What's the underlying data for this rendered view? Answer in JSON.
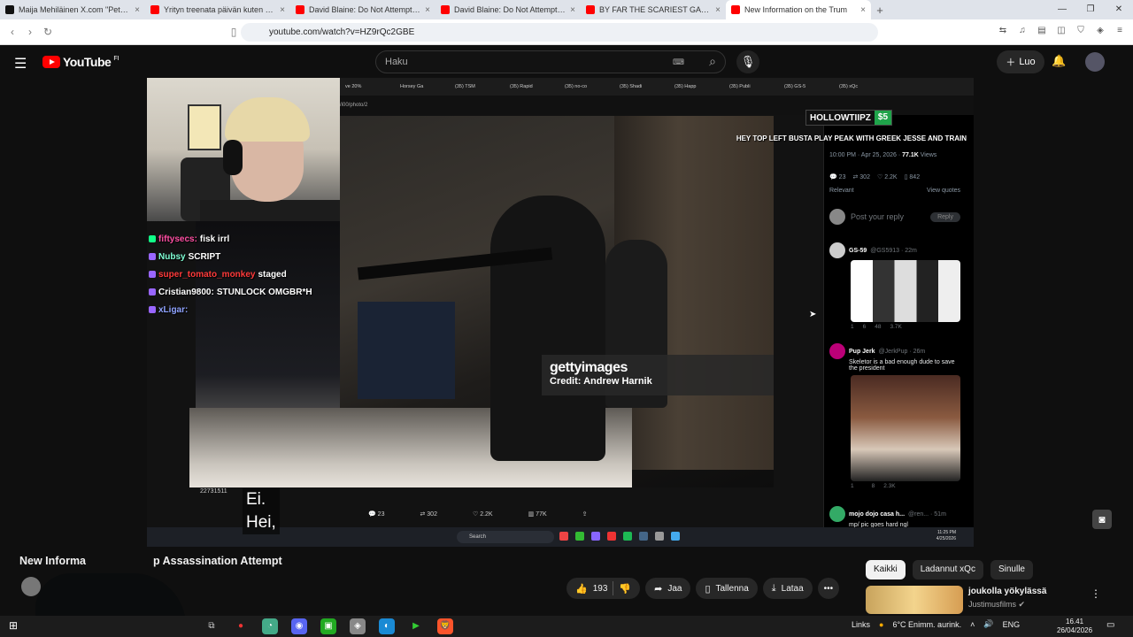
{
  "browser": {
    "tabs": [
      {
        "title": "Maija Mehiläinen X.com \"Petra Nyqvi",
        "color": "#111111"
      },
      {
        "title": "Yrityn treenata päivän kuten Khabs -",
        "color": "#ff0000"
      },
      {
        "title": "David Blaine: Do Not Attempt MEGA",
        "color": "#ff0000"
      },
      {
        "title": "David Blaine: Do Not Attempt MEGA",
        "color": "#ff0000"
      },
      {
        "title": "BY FAR THE SCARIEST GAME OF THE",
        "color": "#ff0000"
      },
      {
        "title": "New Information on the Trum",
        "color": "#ff0000",
        "active": true
      }
    ],
    "url": "youtube.com/watch?v=HZ9rQc2GBE"
  },
  "youtube": {
    "logo_text": "YouTube",
    "country_code": "FI",
    "search_placeholder": "Haku",
    "create_label": "Luo"
  },
  "stream": {
    "hollow_name": "HOLLOWTIIPZ",
    "hollow_amount": "$5",
    "alert_text": "HEY TOP LEFT BUSTA PLAY PEAK WITH GREEK JESSE AND TRAIN",
    "chat": [
      {
        "user": "fiftysecs:",
        "msg": "fisk irrl",
        "color": "#ff4fa3"
      },
      {
        "user": "Nubsy",
        "msg": "SCRIPT",
        "color": "#7fffd4"
      },
      {
        "user": "super_tomato_monkey",
        "msg": "staged",
        "color": "#ff3a3a"
      },
      {
        "user": "Cristian9800:",
        "msg": "STUNLOCK OMGBR*H",
        "color": "#ffffff"
      },
      {
        "user": "xLigar:",
        "msg": "",
        "color": "#8fa3ff"
      }
    ],
    "inner_tabs": [
      "ve 20%",
      "Horsey Ga",
      "(35) TSM",
      "(35) Rapid",
      "(35) no-co",
      "(35) Shadi",
      "(35) Happ",
      "(35) Publi",
      "(35) GS-5",
      "(35) xQc"
    ],
    "inner_url": "/i00/photo/2",
    "getty_brand": "gettyimages",
    "getty_credit": "Credit: Andrew Harnik",
    "subtitle_line1": "Ei.",
    "subtitle_line2": "Hei,",
    "video_time": "22731511"
  },
  "tweet": {
    "handle": "@GS5913",
    "timestamp": "10:00 PM · Apr 25, 2026 ·",
    "views": "77.1K",
    "views_label": "Views",
    "stats": [
      "23",
      "302",
      "2.2K",
      "842"
    ],
    "relevant": "Relevant",
    "view_quotes": "View quotes",
    "reply_placeholder": "Post your reply",
    "reply_button": "Reply",
    "bottom_stats": [
      "23",
      "302",
      "2.2K",
      "77K"
    ],
    "replies": [
      {
        "name": "GS-59",
        "handle": "@GS5913 · 22m",
        "text": "",
        "acts": [
          "1",
          "6",
          "48",
          "3.7K"
        ]
      },
      {
        "name": "Pup Jerk",
        "handle": "@JerkPup · 26m",
        "text": "Skeletor is a bad enough dude to save the president",
        "acts": [
          "1",
          "",
          "8",
          "2.3K"
        ]
      },
      {
        "name": "mojo dojo casa h...",
        "handle": "@ren... · 51m",
        "text": "mp/ pic goes hard ngl",
        "acts": []
      }
    ]
  },
  "inner_taskbar": {
    "search": "Search",
    "time": "11:25 PM",
    "date": "4/25/2026"
  },
  "video": {
    "title_left": "New Informa",
    "title_right": "p Assassination Attempt",
    "likes": "193",
    "share": "Jaa",
    "save": "Tallenna",
    "download": "Lataa"
  },
  "recommend": {
    "chips": [
      "Kaikki",
      "Ladannut xQc",
      "Sinulle"
    ],
    "title": "joukolla yökylässä",
    "channel": "Justimusfilms"
  },
  "taskbar": {
    "links": "Links",
    "weather": "6°C  Enimm. aurink.",
    "lang": "ENG",
    "time": "16.41",
    "date": "26/04/2026"
  }
}
